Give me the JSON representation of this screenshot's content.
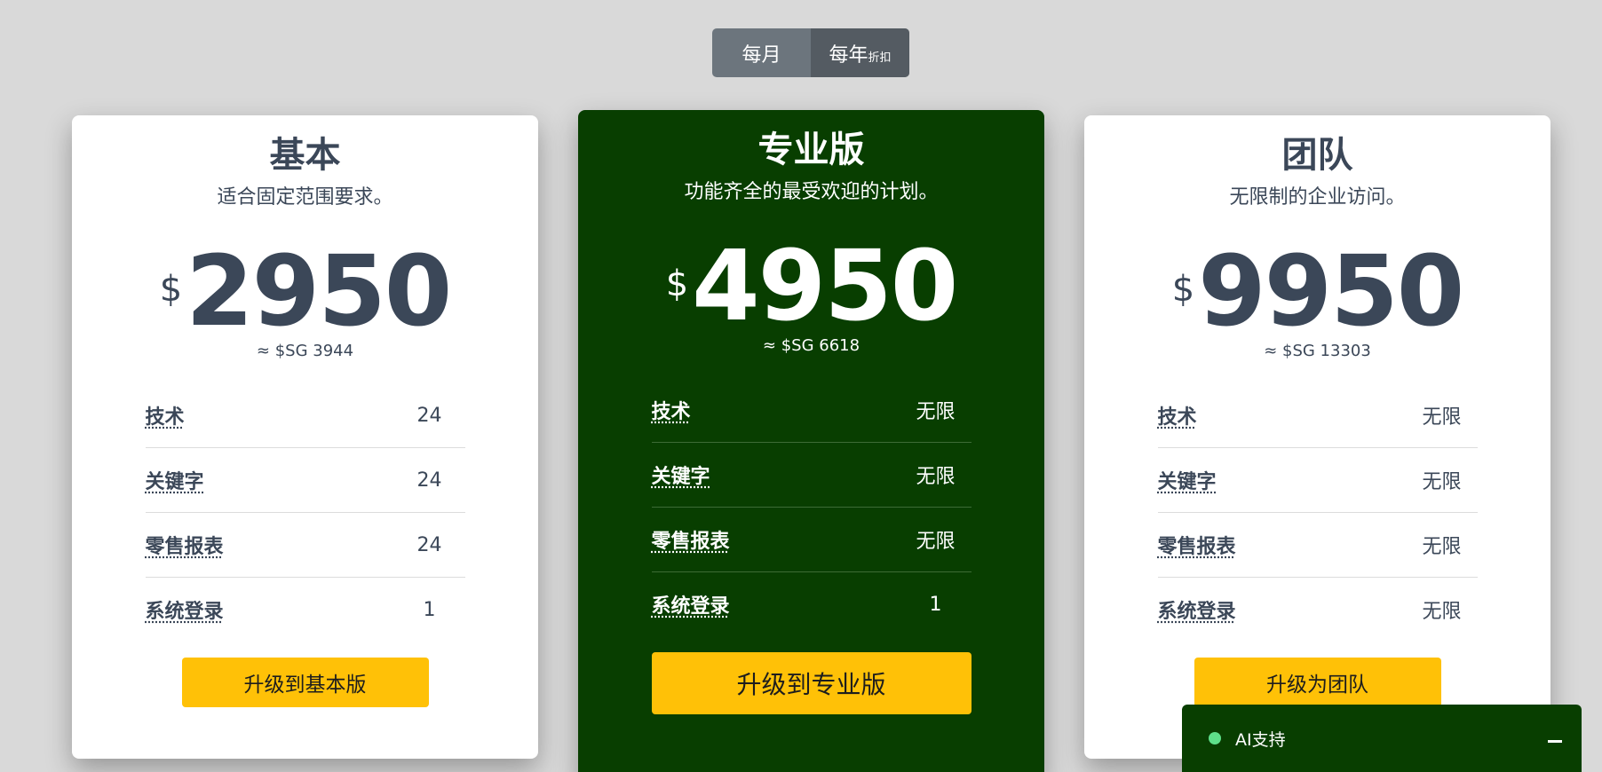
{
  "toggle": {
    "monthly_label": "每月",
    "yearly_label": "每年",
    "yearly_badge": "折扣"
  },
  "plans": [
    {
      "name": "基本",
      "description": "适合固定范围要求。",
      "currency": "$",
      "price": "2950",
      "converted": "≈ $SG 3944",
      "features": [
        {
          "label": "技术",
          "value": "24"
        },
        {
          "label": "关键字",
          "value": "24"
        },
        {
          "label": "零售报表",
          "value": "24"
        },
        {
          "label": "系统登录",
          "value": "1"
        }
      ],
      "cta": "升级到基本版"
    },
    {
      "name": "专业版",
      "description": "功能齐全的最受欢迎的计划。",
      "currency": "$",
      "price": "4950",
      "converted": "≈ $SG 6618",
      "features": [
        {
          "label": "技术",
          "value": "无限"
        },
        {
          "label": "关键字",
          "value": "无限"
        },
        {
          "label": "零售报表",
          "value": "无限"
        },
        {
          "label": "系统登录",
          "value": "1"
        }
      ],
      "cta": "升级到专业版"
    },
    {
      "name": "团队",
      "description": "无限制的企业访问。",
      "currency": "$",
      "price": "9950",
      "converted": "≈ $SG 13303",
      "features": [
        {
          "label": "技术",
          "value": "无限"
        },
        {
          "label": "关键字",
          "value": "无限"
        },
        {
          "label": "零售报表",
          "value": "无限"
        },
        {
          "label": "系统登录",
          "value": "无限"
        }
      ],
      "cta": "升级为团队"
    }
  ],
  "ai_widget": {
    "label": "AI支持",
    "status_color": "#5ee08a"
  },
  "colors": {
    "background": "#d9d9d9",
    "pro_card": "#083e00",
    "accent_button": "#ffc107",
    "text": "#3b4758"
  }
}
